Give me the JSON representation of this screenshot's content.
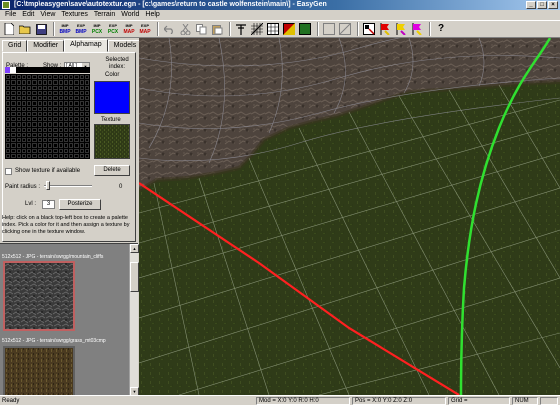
{
  "window": {
    "title": "[C:\\tmp\\easygen\\save\\autotextur.egn - [c:\\games\\return to castle wolfenstein\\main\\] - EasyGen",
    "controls": [
      "_",
      "□",
      "×"
    ]
  },
  "menu": [
    "File",
    "Edit",
    "View",
    "Textures",
    "Terrain",
    "World",
    "Help"
  ],
  "toolbar": {
    "bmp_label": "BMP",
    "pcx_label": "PCX",
    "map_label": "MAP",
    "exp_label": "EXP",
    "imp_label": "IMP",
    "help_label": "?"
  },
  "tabs": [
    "Grid",
    "Modifier",
    "Alphamap",
    "Models"
  ],
  "alphamap": {
    "palette_label": "Palette :",
    "show_label": "Show :",
    "show_value": "[ All ]",
    "selected_index_label": "Selected index:",
    "color_label": "Color",
    "texture_label": "Texture",
    "show_texture_label": "Show texture if available",
    "delete_label": "Delete",
    "paint_radius_label": "Paint radius :",
    "paint_radius_value": "0",
    "lvl_label": "Lvl :",
    "lvl_value": "3",
    "posterize_label": "Posterize",
    "help_text": "Help: click on a black top-left box to create a palette index. Pick a color for it and then assign a texture by clicking one in the texture window."
  },
  "texture_browser": {
    "items": [
      {
        "caption": "512x512 - JPG - terrain/swrgg/mountain_cliffs"
      },
      {
        "caption": "512x512 - JPG - terrain/swrgg/grass_mt03cmp"
      }
    ]
  },
  "statusbar": {
    "ready": "Ready",
    "mod": "Mod = X:0 Y:0 R:0 H:0",
    "pos": "Pos = X:0 Y:0 Z:0 Z:0",
    "grid": "Grid =",
    "num": "NUM"
  },
  "colors": {
    "selected_index": "#0000ff",
    "titlebar": "#0a246a",
    "red_line": "#ff2020",
    "green_line": "#30e030"
  }
}
